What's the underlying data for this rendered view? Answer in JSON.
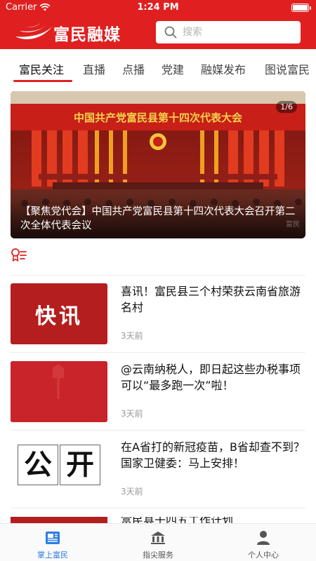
{
  "status_bar": {
    "carrier": "Carrier",
    "time": "1:24 PM"
  },
  "header": {
    "brand": "富民融媒",
    "search_placeholder": "搜索",
    "accent_color": "#e02020"
  },
  "tabs": [
    {
      "label": "富民关注",
      "active": true
    },
    {
      "label": "直播",
      "active": false
    },
    {
      "label": "点播",
      "active": false
    },
    {
      "label": "党建",
      "active": false
    },
    {
      "label": "融媒发布",
      "active": false
    },
    {
      "label": "图说富民",
      "active": false
    }
  ],
  "banner": {
    "counter": "1/6",
    "stage_title": "中国共产党富民县第十四次代表大会",
    "caption": "【聚焦党代会】中国共产党富民县第十四次代表大会召开第二次全体代表会议",
    "watermark": "富民"
  },
  "section_icon": "ribbon-list-icon",
  "news": [
    {
      "title": "喜讯！富民县三个村荣获云南省旅游名村",
      "time": "3天前",
      "thumb_text": "快讯"
    },
    {
      "title": "@云南纳税人，即日起这些办税事项可以“最多跑一次”啦！",
      "time": "3天前",
      "thumb_text": ""
    },
    {
      "title": "在A省打的新冠疫苗，B省却查不到？国家卫健委：马上安排！",
      "time": "3天前",
      "thumb_chars": [
        "公",
        "开"
      ]
    }
  ],
  "peek": {
    "title": "富民县十四五工作计划"
  },
  "tabbar": [
    {
      "label": "掌上富民",
      "icon": "newspaper-icon",
      "active": true
    },
    {
      "label": "指尖服务",
      "icon": "bank-icon",
      "active": false
    },
    {
      "label": "个人中心",
      "icon": "person-icon",
      "active": false
    }
  ],
  "colors": {
    "active_tab": "#2f7de0",
    "time_gray": "#999999"
  }
}
